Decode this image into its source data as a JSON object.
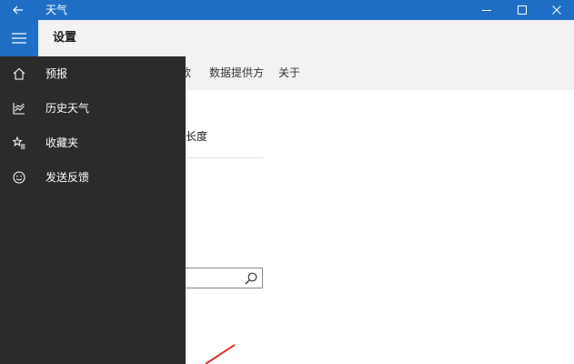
{
  "window": {
    "title": "天气"
  },
  "header": {
    "page_title": "设置"
  },
  "tabs": [
    {
      "label": "款"
    },
    {
      "label": "数据提供方"
    },
    {
      "label": "关于"
    }
  ],
  "content": {
    "setting_label": "长度",
    "search_value": "",
    "search_placeholder": ""
  },
  "nav": {
    "items": [
      {
        "label": "预报",
        "icon": "home-icon"
      },
      {
        "label": "历史天气",
        "icon": "chart-icon"
      },
      {
        "label": "收藏夹",
        "icon": "star-list-icon"
      },
      {
        "label": "发送反馈",
        "icon": "smiley-icon"
      }
    ]
  },
  "colors": {
    "accent": "#1e6fc5",
    "nav_background": "#2b2b2b",
    "header_background": "#f2f2f2",
    "annotation": "#d93025"
  }
}
